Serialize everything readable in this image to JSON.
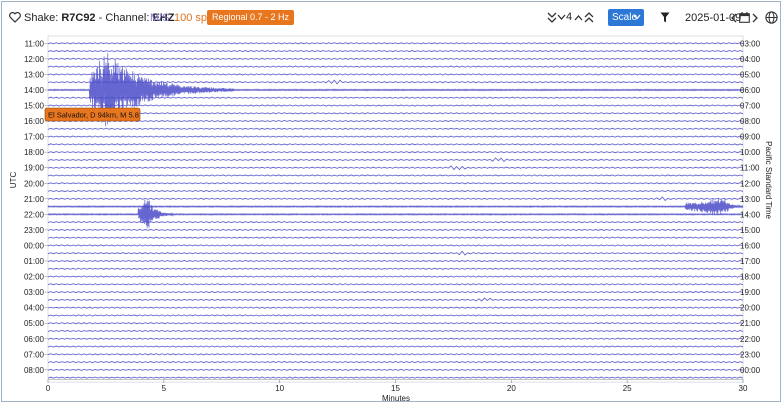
{
  "toolbar": {
    "shake_prefix": "Shake: ",
    "station": "R7C92",
    "channel_prefix": " - Channel: ",
    "channel": "EHZ",
    "units": "M/S",
    "sample_rate": "100 sps",
    "filter_badge": "Regional 0.7 - 2 Hz",
    "zoom_level": "4",
    "scale_label": "Scale",
    "date": "2025-01-09",
    "icons": [
      "heart-icon",
      "double-chevron-down-icon",
      "chevron-down-icon",
      "chevron-up-icon",
      "double-chevron-up-icon",
      "chevron-down-icon",
      "funnel-icon",
      "arrow-left-icon",
      "calendar-icon",
      "arrow-right-icon",
      "globe-icon"
    ]
  },
  "chart_data": {
    "type": "line",
    "title": "",
    "xlabel": "Minutes",
    "ylabel_left": "UTC",
    "ylabel_right": "Pacific Standard Time",
    "xlim": [
      0,
      30
    ],
    "x_ticks": [
      "0",
      "5",
      "10",
      "15",
      "20",
      "25",
      "30"
    ],
    "left_ticks": [
      "11:00",
      "12:00",
      "13:00",
      "14:00",
      "15:00",
      "16:00",
      "17:00",
      "18:00",
      "19:00",
      "20:00",
      "21:00",
      "22:00",
      "23:00",
      "00:00",
      "01:00",
      "02:00",
      "03:00",
      "04:00",
      "05:00",
      "06:00",
      "07:00",
      "08:00"
    ],
    "right_ticks": [
      "03:00",
      "04:00",
      "05:00",
      "06:00",
      "07:00",
      "08:00",
      "09:00",
      "10:00",
      "11:00",
      "12:00",
      "13:00",
      "14:00",
      "15:00",
      "16:00",
      "17:00",
      "18:00",
      "19:00",
      "20:00",
      "21:00",
      "22:00",
      "23:00",
      "00:00"
    ],
    "rows_per_hour": 2,
    "trace_color": "#4b4bc8",
    "grid": true,
    "event_label": "El Salvador, D 94km, M 5.8",
    "events": [
      {
        "row": 6,
        "start_min": 1.8,
        "peak_min": 2.5,
        "end_min": 8.0,
        "amplitude": 1.0
      },
      {
        "row": 22,
        "start_min": 3.9,
        "peak_min": 4.3,
        "end_min": 5.4,
        "amplitude": 0.45
      },
      {
        "row": 21,
        "start_min": 27.5,
        "peak_min": 29.2,
        "end_min": 30.0,
        "amplitude": 0.22
      }
    ],
    "blips": [
      {
        "row": 5,
        "min": 12.3
      },
      {
        "row": 15,
        "min": 19.5
      },
      {
        "row": 27,
        "min": 18.1
      },
      {
        "row": 16,
        "min": 17.7
      },
      {
        "row": 33,
        "min": 18.8
      },
      {
        "row": 20,
        "min": 26.6
      }
    ]
  }
}
